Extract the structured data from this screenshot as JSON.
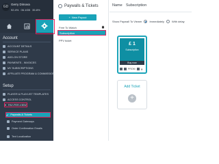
{
  "profile": {
    "avatar": "GD",
    "name": "Gerry Dimova",
    "stats": [
      "92.4%",
      "06.1GB",
      "35.8%"
    ]
  },
  "sidebar": {
    "tabs": [
      {
        "icon": "home-icon"
      },
      {
        "icon": "analytics-icon"
      },
      {
        "icon": "gear-icon"
      }
    ],
    "account_title": "Account",
    "account_items": [
      "ACCOUNT DETAILS",
      "SERVICE PLANS",
      "ADD-ON STORE",
      "PAYMENTS - INVOICES",
      "MY SUBSCRIPTIONS",
      "AFFILIATE PROGRAM & COMMISSIONS"
    ],
    "setup_title": "Setup",
    "setup_items": [
      "PLAYER & PLAYLIST TEMPLATES",
      "ACCESS CONTROL",
      "PAY-PER-VIEW"
    ],
    "ppv_sub_items": [
      "Paywalls & Tickets",
      "Payment Gateways",
      "Order Confirmation Emails",
      "Text Localization"
    ]
  },
  "panel": {
    "title": "Paywalls & Tickets",
    "new_payout": "New Payout",
    "items": [
      "Free To Watch",
      "Subscription",
      "PPV ticket"
    ]
  },
  "right": {
    "name_label": "Name",
    "name_value": "Subscription",
    "show_label": "Show Paywall To Viewer",
    "opt_immediately": "Immediately",
    "opt_delay": "With delay",
    "ticket": {
      "price": "£ 1",
      "name": "Subscription",
      "buy": "Buy now",
      "promo": "PROM"
    },
    "add_ticket": "Add Ticket"
  },
  "colors": {
    "accent": "#1aa3b8",
    "highlight": "#e0245e",
    "sidebar": "#2f3a49"
  }
}
